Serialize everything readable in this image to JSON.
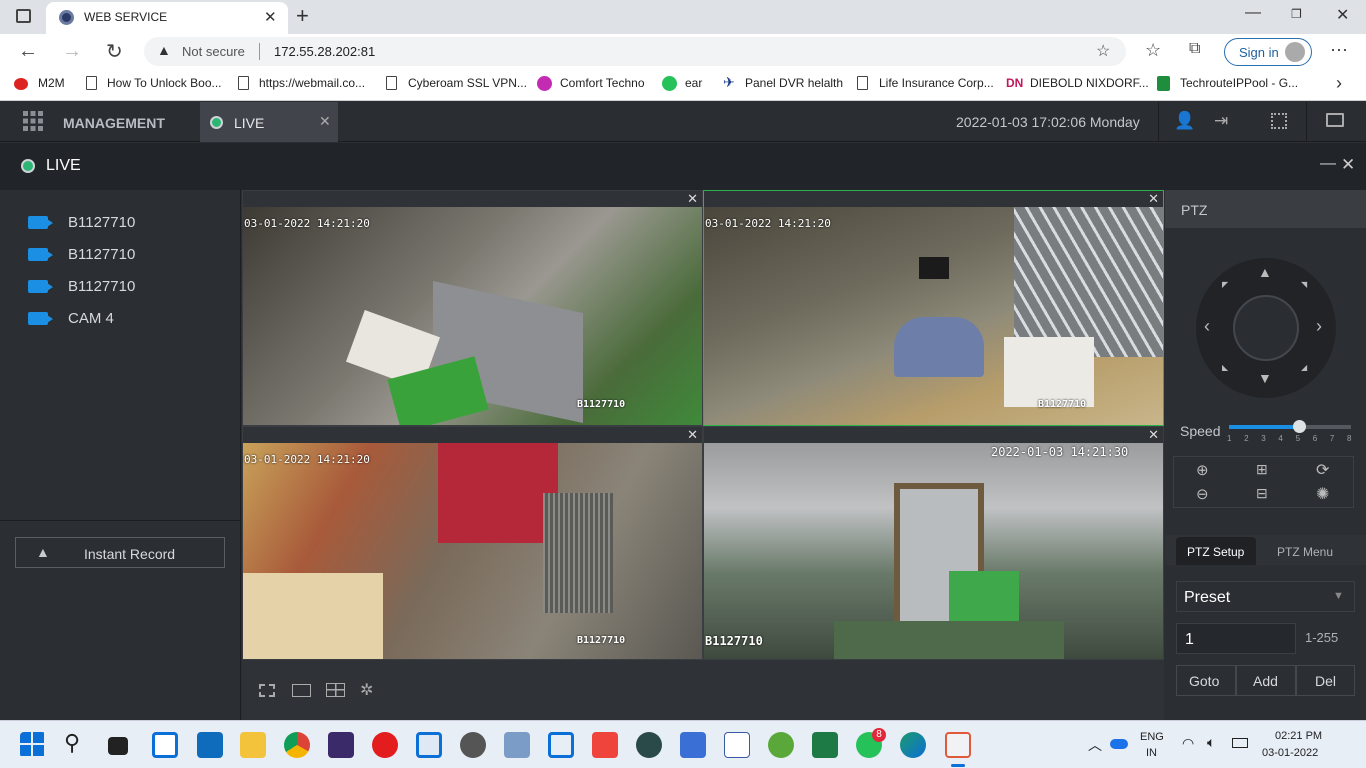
{
  "browser": {
    "tab_title": "WEB SERVICE",
    "security": "Not secure",
    "url": "172.55.28.202:81",
    "sign_in": "Sign in",
    "bookmarks": [
      "M2M",
      "How To Unlock Boo...",
      "https://webmail.co...",
      "Cyberoam SSL VPN...",
      "Comfort Techno",
      "ear",
      "Panel DVR helalth",
      "Life Insurance Corp...",
      "DIEBOLD NIXDORF...",
      "TechrouteIPPool - G..."
    ]
  },
  "app": {
    "management": "MANAGEMENT",
    "live_tab": "LIVE",
    "datetime": "2022-01-03 17:02:06 Monday",
    "live_title": "LIVE"
  },
  "cameras": [
    "B1127710",
    "B1127710",
    "B1127710",
    "CAM 4"
  ],
  "instant_record": "Instant Record",
  "panes": [
    {
      "timestamp": "03-01-2022 14:21:20",
      "label": "B1127710"
    },
    {
      "timestamp": "03-01-2022 14:21:20",
      "label": "B1127710"
    },
    {
      "timestamp": "03-01-2022 14:21:20",
      "label": "B1127710"
    },
    {
      "timestamp": "2022-01-03 14:21:30",
      "label": "B1127710"
    }
  ],
  "ptz": {
    "title": "PTZ",
    "speed_label": "Speed",
    "speed_ticks": [
      "1",
      "2",
      "3",
      "4",
      "5",
      "6",
      "7",
      "8"
    ],
    "speed_value": 5,
    "tab_setup": "PTZ Setup",
    "tab_menu": "PTZ Menu",
    "preset_select": "Preset",
    "preset_value": "1",
    "preset_range": "1-255",
    "goto": "Goto",
    "add": "Add",
    "del": "Del"
  },
  "taskbar": {
    "lang1": "ENG",
    "lang2": "IN",
    "time": "02:21 PM",
    "date": "03-01-2022",
    "whatsapp_badge": "8"
  },
  "colors": {
    "accent": "#1a8fe3",
    "active_border": "#29b34a",
    "live_dot": "#2bb673"
  }
}
